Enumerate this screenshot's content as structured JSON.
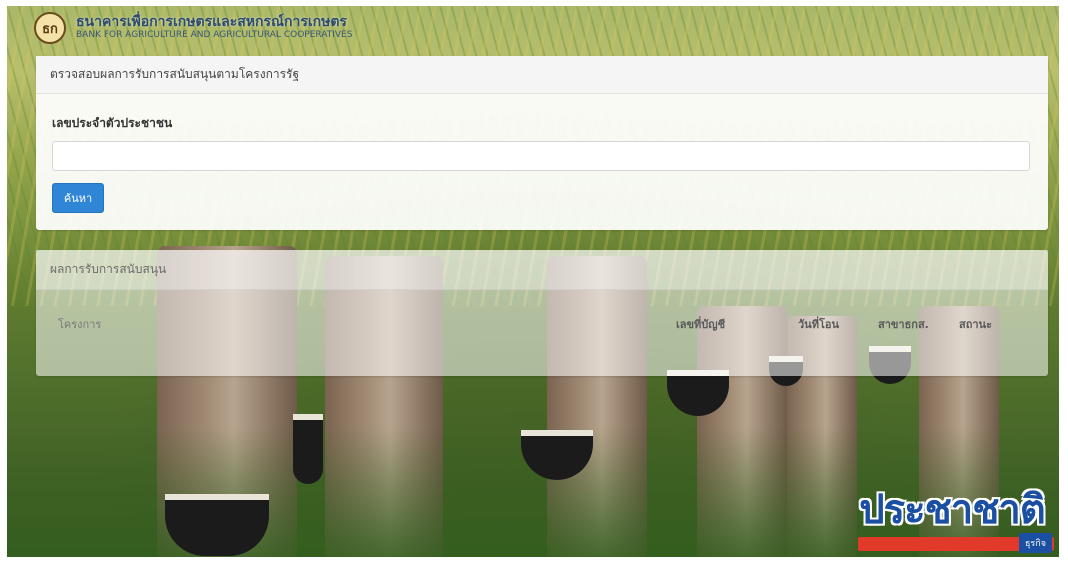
{
  "header": {
    "logo_glyph": "ธก",
    "org_name_th": "ธนาคารเพื่อการเกษตรและสหกรณ์การเกษตร",
    "org_name_en": "BANK FOR AGRICULTURE AND AGRICULTURAL COOPERATIVES"
  },
  "search_panel": {
    "title": "ตรวจสอบผลการรับการสนับสนุนตามโครงการรัฐ",
    "id_label": "เลขประจำตัวประชาชน",
    "id_value": "",
    "id_placeholder": "",
    "search_label": "ค้นหา"
  },
  "results_panel": {
    "title": "ผลการรับการสนับสนุน",
    "columns": {
      "project": "โครงการ",
      "account": "เลขที่บัญชี",
      "date": "วันที่โอน",
      "branch": "สาขาธกส.",
      "status": "สถานะ"
    }
  },
  "watermark": {
    "brand": "ประชาชาติ",
    "sub": "ธุรกิจ"
  },
  "colors": {
    "primary_button": "#2f86d6",
    "brand_blue": "#1a4fa3",
    "brand_red": "#e23a2a"
  }
}
